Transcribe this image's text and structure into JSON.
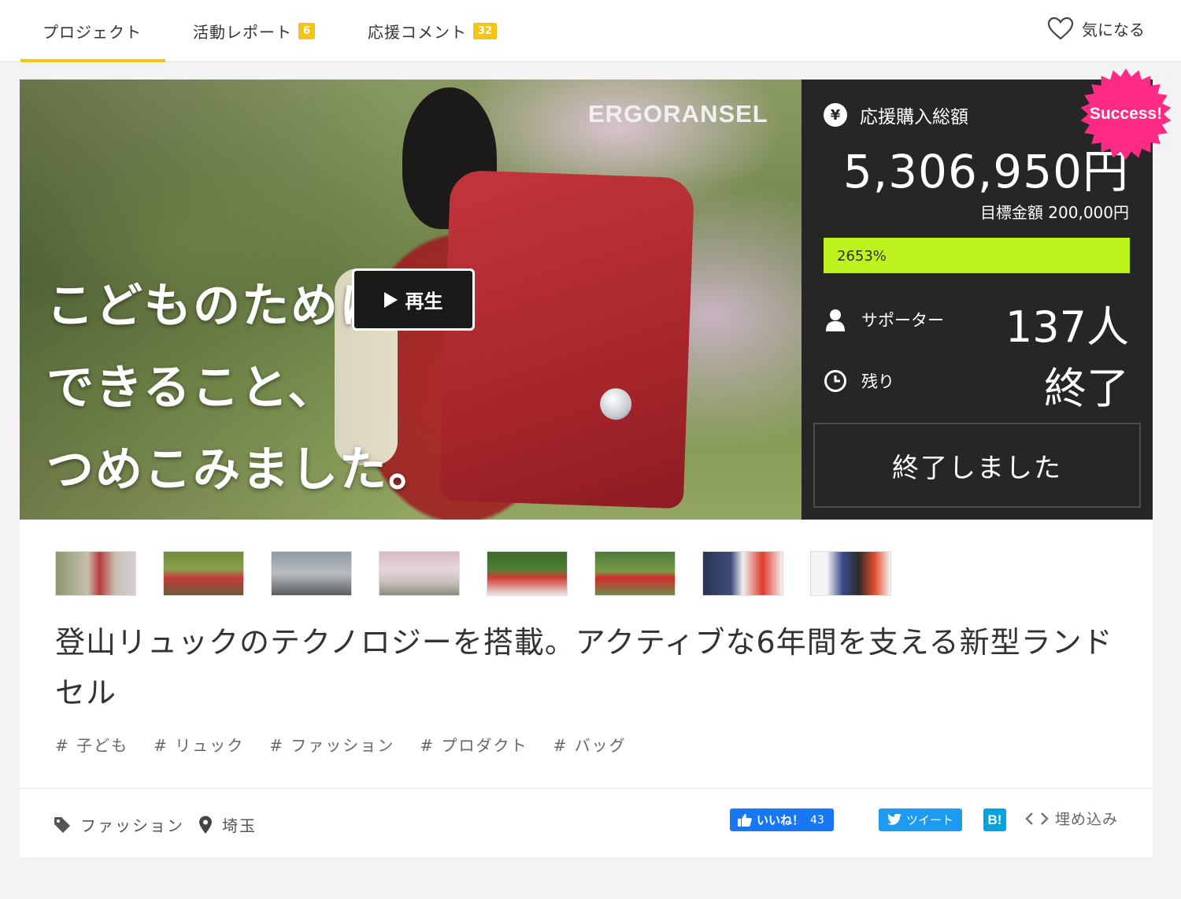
{
  "nav": {
    "tabs": [
      {
        "label": "プロジェクト",
        "badge": null
      },
      {
        "label": "活動レポート",
        "badge": "6"
      },
      {
        "label": "応援コメント",
        "badge": "32"
      }
    ],
    "favorite_label": "気になる"
  },
  "hero": {
    "brand": "ERGORANSEL",
    "tagline_lines": [
      "こどものために",
      "できること、",
      "つめこみました。"
    ],
    "play_label": "再生"
  },
  "stats": {
    "total_label": "応援購入総額",
    "total_amount": "5,306,950円",
    "goal_text": "目標金額 200,000円",
    "progress_percent": 2653,
    "progress_label": "2653%",
    "supporters_label": "サポーター",
    "supporters_value": "137人",
    "remaining_label": "残り",
    "remaining_value": "終了",
    "ended_button": "終了しました",
    "success_badge": "Success!",
    "accent_color": "#bdf21c",
    "success_color": "#ff2a83"
  },
  "thumbnails": [
    {
      "name": "thumb-1"
    },
    {
      "name": "thumb-2"
    },
    {
      "name": "thumb-3"
    },
    {
      "name": "thumb-4"
    },
    {
      "name": "thumb-5"
    },
    {
      "name": "thumb-6"
    },
    {
      "name": "thumb-7"
    },
    {
      "name": "thumb-8"
    }
  ],
  "title": "登山リュックのテクノロジーを搭載。アクティブな6年間を支える新型ランドセル",
  "tags": [
    "# 子ども",
    "# リュック",
    "# ファッション",
    "# プロダクト",
    "# バッグ"
  ],
  "meta": {
    "category": "ファッション",
    "location": "埼玉"
  },
  "share": {
    "facebook_label": "いいね！",
    "facebook_count": "43",
    "twitter_label": "ツイート",
    "hatena_label": "B!",
    "embed_label": "埋め込み"
  }
}
